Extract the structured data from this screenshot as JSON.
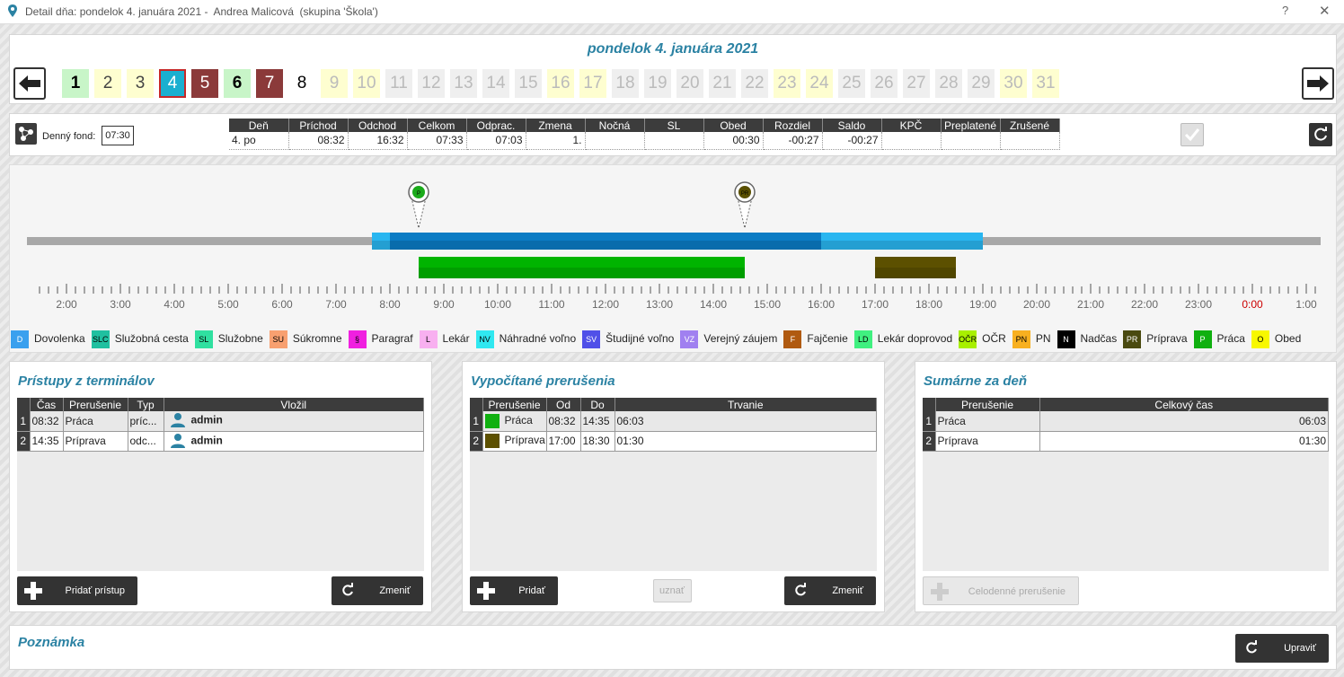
{
  "window": {
    "title": "Detail dňa: pondelok 4. januára 2021 -  Andrea Malicová  (skupina 'Škola')",
    "help": "?",
    "close": "✕"
  },
  "header": {
    "date": "pondelok 4. januára 2021"
  },
  "calendar": {
    "days": [
      {
        "n": "1",
        "bg": "#c8f5c8",
        "fg": "#000",
        "bold": true
      },
      {
        "n": "2",
        "bg": "#fefed0",
        "fg": "#444",
        "bold": false
      },
      {
        "n": "3",
        "bg": "#fefed0",
        "fg": "#444",
        "bold": false
      },
      {
        "n": "4",
        "bg": "#1aafd0",
        "fg": "#fff",
        "bold": false,
        "sel": true
      },
      {
        "n": "5",
        "bg": "#8b3a3a",
        "fg": "#fff",
        "bold": false
      },
      {
        "n": "6",
        "bg": "#c8f5c8",
        "fg": "#000",
        "bold": true
      },
      {
        "n": "7",
        "bg": "#8b3a3a",
        "fg": "#fff",
        "bold": false
      },
      {
        "n": "8",
        "bg": "#ffffff",
        "fg": "#000",
        "bold": false
      },
      {
        "n": "9",
        "bg": "#fefed0",
        "fg": "#bbb",
        "bold": false
      },
      {
        "n": "10",
        "bg": "#fefed0",
        "fg": "#bbb",
        "bold": false
      },
      {
        "n": "11",
        "bg": "#efefef",
        "fg": "#bbb",
        "bold": false
      },
      {
        "n": "12",
        "bg": "#efefef",
        "fg": "#bbb",
        "bold": false
      },
      {
        "n": "13",
        "bg": "#efefef",
        "fg": "#bbb",
        "bold": false
      },
      {
        "n": "14",
        "bg": "#efefef",
        "fg": "#bbb",
        "bold": false
      },
      {
        "n": "15",
        "bg": "#efefef",
        "fg": "#bbb",
        "bold": false
      },
      {
        "n": "16",
        "bg": "#fefed0",
        "fg": "#bbb",
        "bold": false
      },
      {
        "n": "17",
        "bg": "#fefed0",
        "fg": "#bbb",
        "bold": false
      },
      {
        "n": "18",
        "bg": "#efefef",
        "fg": "#bbb",
        "bold": false
      },
      {
        "n": "19",
        "bg": "#efefef",
        "fg": "#bbb",
        "bold": false
      },
      {
        "n": "20",
        "bg": "#efefef",
        "fg": "#bbb",
        "bold": false
      },
      {
        "n": "21",
        "bg": "#efefef",
        "fg": "#bbb",
        "bold": false
      },
      {
        "n": "22",
        "bg": "#efefef",
        "fg": "#bbb",
        "bold": false
      },
      {
        "n": "23",
        "bg": "#fefed0",
        "fg": "#bbb",
        "bold": false
      },
      {
        "n": "24",
        "bg": "#fefed0",
        "fg": "#bbb",
        "bold": false
      },
      {
        "n": "25",
        "bg": "#efefef",
        "fg": "#bbb",
        "bold": false
      },
      {
        "n": "26",
        "bg": "#efefef",
        "fg": "#bbb",
        "bold": false
      },
      {
        "n": "27",
        "bg": "#efefef",
        "fg": "#bbb",
        "bold": false
      },
      {
        "n": "28",
        "bg": "#efefef",
        "fg": "#bbb",
        "bold": false
      },
      {
        "n": "29",
        "bg": "#efefef",
        "fg": "#bbb",
        "bold": false
      },
      {
        "n": "30",
        "bg": "#fefed0",
        "fg": "#bbb",
        "bold": false
      },
      {
        "n": "31",
        "bg": "#fefed0",
        "fg": "#bbb",
        "bold": false
      }
    ]
  },
  "summary": {
    "fund_label": "Denný fond:",
    "fund_value": "07:30",
    "headers": [
      "Deň",
      "Príchod",
      "Odchod",
      "Celkom",
      "Odprac.",
      "Zmena",
      "Nočná",
      "SL",
      "Obed",
      "Rozdiel",
      "Saldo",
      "KPČ",
      "Preplatené",
      "Zrušené"
    ],
    "row": [
      "4. po",
      "08:32",
      "16:32",
      "07:33",
      "07:03",
      "1.",
      "",
      "",
      "00:30",
      "-00:27",
      "-00:27",
      "",
      "",
      ""
    ]
  },
  "timeline": {
    "hour_labels": [
      "2:00",
      "3:00",
      "4:00",
      "5:00",
      "6:00",
      "7:00",
      "8:00",
      "9:00",
      "10:00",
      "11:00",
      "12:00",
      "13:00",
      "14:00",
      "15:00",
      "16:00",
      "17:00",
      "18:00",
      "19:00",
      "20:00",
      "21:00",
      "22:00",
      "23:00",
      "0:00",
      "1:00"
    ],
    "shift": {
      "start": "07:40",
      "end": "19:00",
      "core_start": "08:00",
      "core_end": "16:00"
    },
    "markers": [
      {
        "time": "08:32",
        "label": "P",
        "color": "#1aaa1a"
      },
      {
        "time": "14:35",
        "label": "PR",
        "color": "#5a5000"
      }
    ],
    "intervals": [
      {
        "from": "08:32",
        "to": "14:35",
        "color": "#00b400"
      },
      {
        "from": "17:00",
        "to": "18:30",
        "color": "#5c5000"
      }
    ],
    "midnight_color": "#cc0000"
  },
  "legend": [
    {
      "code": "D",
      "label": "Dovolenka",
      "bg": "#3aa0ee",
      "fg": "#fff"
    },
    {
      "code": "SLC",
      "label": "Služobná cesta",
      "bg": "#20c0a0",
      "fg": "#000"
    },
    {
      "code": "SL",
      "label": "Služobne",
      "bg": "#30e0a0",
      "fg": "#000"
    },
    {
      "code": "SU",
      "label": "Súkromne",
      "bg": "#f8a070",
      "fg": "#000"
    },
    {
      "code": "§",
      "label": "Paragraf",
      "bg": "#f020e0",
      "fg": "#000"
    },
    {
      "code": "L",
      "label": "Lekár",
      "bg": "#f8b0f0",
      "fg": "#000"
    },
    {
      "code": "NV",
      "label": "Náhradné voľno",
      "bg": "#30e8f0",
      "fg": "#000"
    },
    {
      "code": "SV",
      "label": "Študijné voľno",
      "bg": "#5050e8",
      "fg": "#fff"
    },
    {
      "code": "VZ",
      "label": "Verejný záujem",
      "bg": "#a080f0",
      "fg": "#fff"
    },
    {
      "code": "F",
      "label": "Fajčenie",
      "bg": "#b05a10",
      "fg": "#fff"
    },
    {
      "code": "LD",
      "label": "Lekár doprovod",
      "bg": "#40f080",
      "fg": "#000"
    },
    {
      "code": "OČR",
      "label": "OČR",
      "bg": "#a8f000",
      "fg": "#000"
    },
    {
      "code": "PN",
      "label": "PN",
      "bg": "#f8b020",
      "fg": "#000"
    },
    {
      "code": "N",
      "label": "Nadčas",
      "bg": "#000000",
      "fg": "#fff"
    },
    {
      "code": "PR",
      "label": "Príprava",
      "bg": "#4a4a10",
      "fg": "#fff"
    },
    {
      "code": "P",
      "label": "Práca",
      "bg": "#10b010",
      "fg": "#fff"
    },
    {
      "code": "O",
      "label": "Obed",
      "bg": "#f8f800",
      "fg": "#000"
    }
  ],
  "access": {
    "title": "Prístupy z terminálov",
    "headers": [
      "Čas",
      "Prerušenie",
      "Typ",
      "Vložil"
    ],
    "rows": [
      {
        "n": "1",
        "time": "08:32",
        "type": "Práca",
        "kind": "príc...",
        "user": "admin"
      },
      {
        "n": "2",
        "time": "14:35",
        "type": "Príprava",
        "kind": "odc...",
        "user": "admin"
      }
    ],
    "add_label": "Pridať prístup",
    "change_label": "Zmeniť"
  },
  "computed": {
    "title": "Vypočítané prerušenia",
    "headers": [
      "Prerušenie",
      "Od",
      "Do",
      "Trvanie"
    ],
    "rows": [
      {
        "n": "1",
        "name": "Práca",
        "color": "#10b010",
        "from": "08:32",
        "to": "14:35",
        "dur": "06:03"
      },
      {
        "n": "2",
        "name": "Príprava",
        "color": "#5c5000",
        "from": "17:00",
        "to": "18:30",
        "dur": "01:30"
      }
    ],
    "add_label": "Pridať",
    "accept_label": "uznať",
    "change_label": "Zmeniť"
  },
  "daysum": {
    "title": "Sumárne za deň",
    "headers": [
      "Prerušenie",
      "Celkový čas"
    ],
    "rows": [
      {
        "n": "1",
        "name": "Práca",
        "total": "06:03"
      },
      {
        "n": "2",
        "name": "Príprava",
        "total": "01:30"
      }
    ],
    "fullday_label": "Celodenné prerušenie"
  },
  "note": {
    "title": "Poznámka",
    "edit_label": "Upraviť"
  }
}
